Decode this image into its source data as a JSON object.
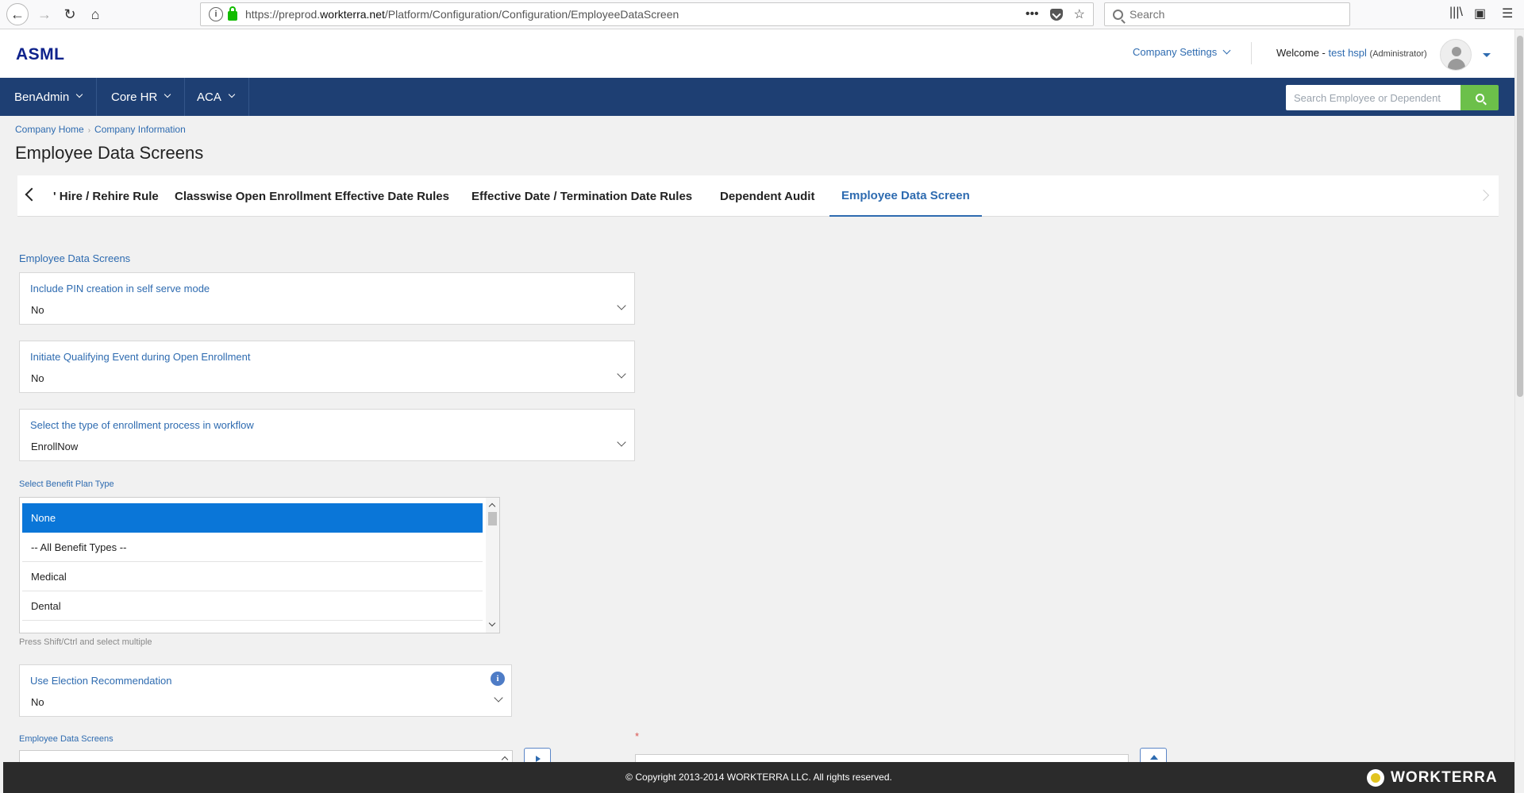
{
  "browser": {
    "url_prefix": "https://preprod.",
    "url_domain": "workterra.net",
    "url_path": "/Platform/Configuration/Configuration/EmployeeDataScreen",
    "url_menu": "•••",
    "search_placeholder": "Search"
  },
  "header": {
    "logo": "ASML",
    "company_settings": "Company Settings",
    "welcome_prefix": "Welcome - ",
    "user_name": "test hspl",
    "user_role": "(Administrator)"
  },
  "nav": {
    "items": [
      {
        "label": "BenAdmin"
      },
      {
        "label": "Core HR"
      },
      {
        "label": "ACA"
      }
    ],
    "search_placeholder": "Search Employee or Dependent"
  },
  "breadcrumb": [
    "Company Home",
    "Company Information"
  ],
  "page_title": "Employee Data Screens",
  "tabs": [
    {
      "label": "' Hire / Rehire Rule"
    },
    {
      "label": "Classwise Open Enrollment Effective Date Rules"
    },
    {
      "label": "Effective Date / Termination Date Rules"
    },
    {
      "label": "Dependent Audit"
    },
    {
      "label": "Employee Data Screen"
    }
  ],
  "form": {
    "section_label": "Employee Data Screens",
    "fields": [
      {
        "label": "Include PIN creation in self serve mode",
        "value": "No"
      },
      {
        "label": "Initiate Qualifying Event during Open Enrollment",
        "value": "No"
      },
      {
        "label": "Select the type of enrollment process in workflow",
        "value": "EnrollNow"
      }
    ],
    "benefit_plan_label": "Select Benefit Plan Type",
    "benefit_plan_options": [
      "None",
      "-- All Benefit Types --",
      "Medical",
      "Dental"
    ],
    "benefit_plan_selected": "None",
    "multi_select_hint": "Press Shift/Ctrl and select multiple",
    "election_recommendation": {
      "label": "Use Election Recommendation",
      "value": "No",
      "info_glyph": "i"
    },
    "employee_data_screens_label": "Employee Data Screens",
    "required_marker": "*"
  },
  "footer": {
    "copyright": "© Copyright 2013-2014 WORKTERRA LLC. All rights reserved.",
    "brand": "WORKTERRA"
  },
  "colors": {
    "accent": "#2e6bb0",
    "nav_bg": "#1e3f73",
    "search_button": "#6cc04a",
    "selected_option": "#0a76d8",
    "footer_bg": "#2b2b2b"
  }
}
